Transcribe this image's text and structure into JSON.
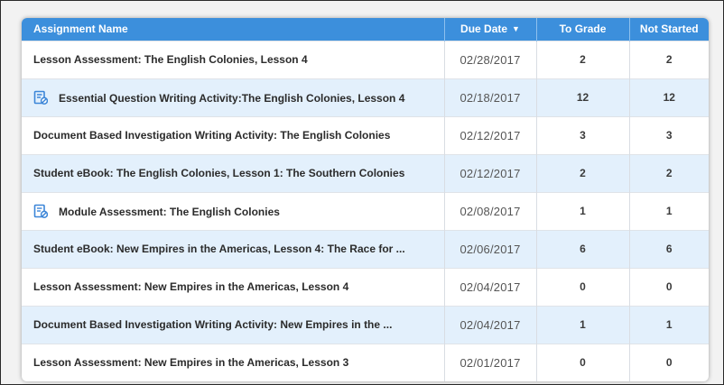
{
  "columns": {
    "name": "Assignment Name",
    "due_date": "Due Date",
    "to_grade": "To Grade",
    "not_started": "Not Started"
  },
  "sort": {
    "column": "due_date",
    "direction": "desc",
    "icon": "caret-down-icon"
  },
  "colors": {
    "header_bg": "#3c8fdc",
    "alt_row_bg": "#e3f0fc",
    "icon": "#3c86d8"
  },
  "rows": [
    {
      "name": "Lesson Assessment: The English Colonies, Lesson 4",
      "due_date": "02/28/2017",
      "to_grade": "2",
      "not_started": "2",
      "icon": null
    },
    {
      "name": "Essential Question Writing Activity:The English Colonies, Lesson 4",
      "due_date": "02/18/2017",
      "to_grade": "12",
      "not_started": "12",
      "icon": "edit-assignment-icon"
    },
    {
      "name": "Document Based Investigation Writing Activity: The English Colonies",
      "due_date": "02/12/2017",
      "to_grade": "3",
      "not_started": "3",
      "icon": null
    },
    {
      "name": "Student eBook: The English Colonies, Lesson 1: The Southern Colonies",
      "due_date": "02/12/2017",
      "to_grade": "2",
      "not_started": "2",
      "icon": null
    },
    {
      "name": "Module Assessment: The English Colonies",
      "due_date": "02/08/2017",
      "to_grade": "1",
      "not_started": "1",
      "icon": "edit-assignment-icon"
    },
    {
      "name": "Student eBook: New Empires in the Americas, Lesson 4: The Race for ...",
      "due_date": "02/06/2017",
      "to_grade": "6",
      "not_started": "6",
      "icon": null
    },
    {
      "name": "Lesson Assessment: New Empires in the Americas, Lesson 4",
      "due_date": "02/04/2017",
      "to_grade": "0",
      "not_started": "0",
      "icon": null
    },
    {
      "name": "Document Based Investigation Writing Activity: New Empires in the ...",
      "due_date": "02/04/2017",
      "to_grade": "1",
      "not_started": "1",
      "icon": null
    },
    {
      "name": "Lesson Assessment: New Empires in the Americas, Lesson 3",
      "due_date": "02/01/2017",
      "to_grade": "0",
      "not_started": "0",
      "icon": null
    }
  ]
}
